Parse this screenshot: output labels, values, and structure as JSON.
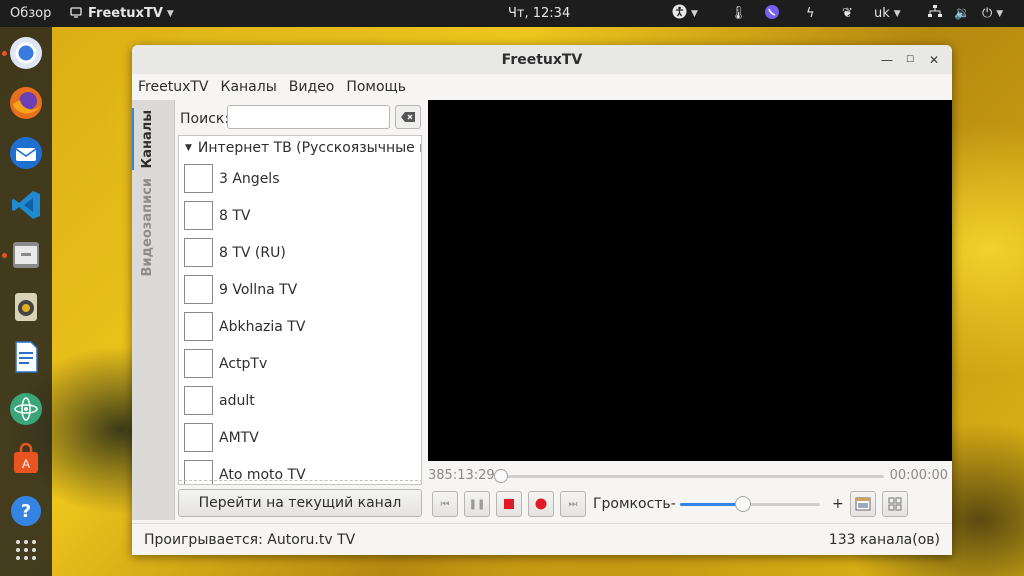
{
  "topbar": {
    "overview": "Обзор",
    "app_name": "FreetuxTV",
    "clock": "Чт, 12:34",
    "keyboard_layout": "uk"
  },
  "dock": {
    "items": [
      {
        "name": "chromium",
        "color": "#3b7be0"
      },
      {
        "name": "firefox",
        "color": "#e8701a"
      },
      {
        "name": "thunderbird",
        "color": "#1f6fd1"
      },
      {
        "name": "vscode",
        "color": "#1f8ad2"
      },
      {
        "name": "files",
        "color": "#7a7a7a"
      },
      {
        "name": "rhythmbox",
        "color": "#e0b020"
      },
      {
        "name": "libreoffice-writer",
        "color": "#2a6fc1"
      },
      {
        "name": "atom",
        "color": "#3aa67a"
      },
      {
        "name": "software",
        "color": "#e95420"
      },
      {
        "name": "help",
        "color": "#3584e4"
      },
      {
        "name": "app-grid",
        "color": "#dddddd"
      }
    ]
  },
  "window": {
    "title": "FreetuxTV",
    "menu": [
      "FreetuxTV",
      "Каналы",
      "Видео",
      "Помощь"
    ],
    "tabs": {
      "channels": "Каналы",
      "recordings": "Видеозаписи"
    },
    "search": {
      "label": "Поиск:",
      "value": "",
      "placeholder": ""
    },
    "group": "Интернет ТВ (Русскоязычные кан",
    "channels": [
      "3 Angels",
      "8 TV",
      "8 TV (RU)",
      "9 Vollna TV",
      "Abkhazia TV",
      "ActpTv",
      "adult",
      "AMTV",
      "Ato moto TV"
    ],
    "goto_button": "Перейти на текущий канал",
    "player": {
      "elapsed": "385:13:29",
      "remaining": "00:00:00",
      "volume_label": "Громкость",
      "volume_minus": "-",
      "volume_plus": "+",
      "volume_level": 0.45
    },
    "status": {
      "playing": "Проигрывается: Autoru.tv TV",
      "count": "133 канала(ов)"
    }
  }
}
